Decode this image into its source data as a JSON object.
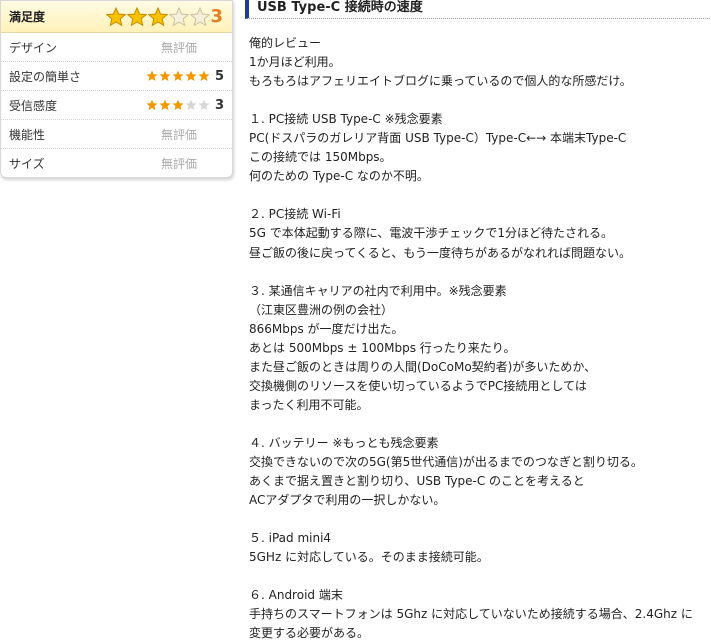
{
  "ratings": {
    "overall": {
      "label": "満足度",
      "score": "3",
      "stars": 3
    },
    "items": [
      {
        "label": "デザイン",
        "unrated": "無評価"
      },
      {
        "label": "設定の簡単さ",
        "score": "5",
        "stars": 5
      },
      {
        "label": "受信感度",
        "score": "3",
        "stars": 3
      },
      {
        "label": "機能性",
        "unrated": "無評価"
      },
      {
        "label": "サイズ",
        "unrated": "無評価"
      }
    ],
    "colors": {
      "star_on": "#f39800",
      "star_off": "#d6d6d6"
    }
  },
  "article": {
    "title": "USB Type-C 接続時の速度",
    "lines": [
      "俺的レビュー",
      "1か月ほど利用。",
      "もろもろはアフェリエイトブログに乗っているので個人的な所感だけ。",
      "",
      "１. PC接続 USB Type-C ※残念要素",
      "PC(ドスパラのガレリア背面 USB Type-C）Type-C←→ 本端末Type-C",
      "この接続では 150Mbps。",
      "何のための Type-C なのか不明。",
      "",
      "２. PC接続 Wi-Fi",
      "5G で本体起動する際に、電波干渉チェックで1分ほど待たされる。",
      "昼ご飯の後に戻ってくると、もう一度待ちがあるがなれれば問題ない。",
      "",
      "３. 某通信キャリアの社内で利用中。※残念要素",
      "（江東区豊洲の例の会社）",
      "866Mbps が一度だけ出た。",
      "あとは 500Mbps ± 100Mbps 行ったり来たり。",
      "また昼ご飯のときは周りの人間(DoCoMo契約者)が多いためか、",
      "交換機側のリソースを使い切っているようでPC接続用としては",
      "まったく利用不可能。",
      "",
      "４. バッテリー ※もっとも残念要素",
      "交換できないので次の5G(第5世代通信)が出るまでのつなぎと割り切る。",
      "あくまで据え置きと割り切り、USB Type-C のことを考えると",
      "ACアダプタで利用の一択しかない。",
      "",
      "５. iPad mini4",
      "5GHz に対応している。そのまま接続可能。",
      "",
      "６. Android 端末",
      "手持ちのスマートフォンは 5Ghz に対応していないため接続する場合、2.4Ghz に",
      "変更する必要がある。"
    ]
  }
}
